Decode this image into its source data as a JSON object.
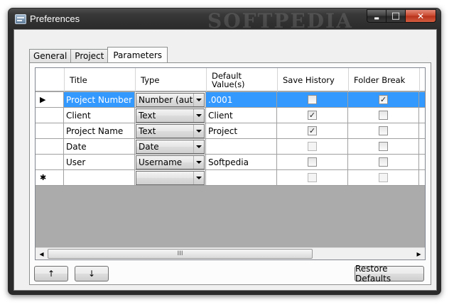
{
  "window": {
    "title": "Preferences",
    "watermark": "SOFTPEDIA",
    "controls": {
      "minimize": "▬",
      "maximize": "□",
      "close": "✕"
    }
  },
  "tabs": [
    {
      "label": "General"
    },
    {
      "label": "Project"
    },
    {
      "label": "Parameters"
    }
  ],
  "grid": {
    "columns": [
      "Title",
      "Type",
      "Default Value(s)",
      "Save History",
      "Folder Break"
    ],
    "rows": [
      {
        "indicator": "▶",
        "title": "Project Number",
        "type": "Number (auto...",
        "default": ".0001",
        "save_history": false,
        "folder_break": true,
        "selected": true,
        "history_disabled": false,
        "folder_disabled": false
      },
      {
        "indicator": "",
        "title": "Client",
        "type": "Text",
        "default": "Client",
        "save_history": true,
        "folder_break": false,
        "selected": false,
        "history_disabled": false,
        "folder_disabled": false
      },
      {
        "indicator": "",
        "title": "Project Name",
        "type": "Text",
        "default": "Project",
        "save_history": true,
        "folder_break": false,
        "selected": false,
        "history_disabled": false,
        "folder_disabled": false
      },
      {
        "indicator": "",
        "title": "Date",
        "type": "Date",
        "default": "",
        "save_history": false,
        "folder_break": false,
        "selected": false,
        "history_disabled": true,
        "folder_disabled": false
      },
      {
        "indicator": "",
        "title": "User",
        "type": "Username",
        "default": "Softpedia",
        "save_history": false,
        "folder_break": false,
        "selected": false,
        "history_disabled": false,
        "folder_disabled": false
      },
      {
        "indicator": "✱",
        "title": "",
        "type": "",
        "default": "",
        "save_history": false,
        "folder_break": false,
        "selected": false,
        "history_disabled": true,
        "folder_disabled": true
      }
    ],
    "scroll_thumb_grip": "III",
    "scroll_left": "◂",
    "scroll_right": "▸"
  },
  "buttons": {
    "move_up": "↑",
    "move_down": "↓",
    "restore_defaults": "Restore Defaults"
  }
}
